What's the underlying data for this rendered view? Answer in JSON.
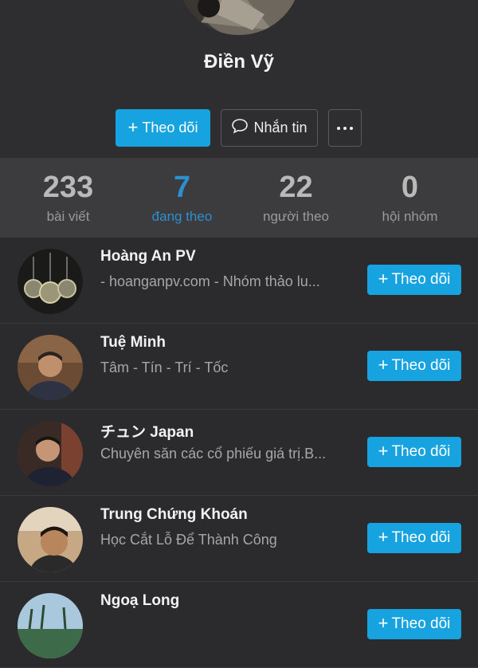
{
  "profile": {
    "name": "Điền Vỹ",
    "follow_label": "Theo dõi",
    "message_label": "Nhắn tin"
  },
  "stats": [
    {
      "value": "233",
      "label": "bài viết",
      "active": false
    },
    {
      "value": "7",
      "label": "đang theo",
      "active": true
    },
    {
      "value": "22",
      "label": "người theo",
      "active": false
    },
    {
      "value": "0",
      "label": "hội nhóm",
      "active": false
    }
  ],
  "users": [
    {
      "name": "Hoàng An PV",
      "description": "- hoanganpv.com - Nhóm thảo lu...",
      "button": "Theo dõi"
    },
    {
      "name": "Tuệ Minh",
      "description": "Tâm - Tín - Trí - Tốc",
      "button": "Theo dõi"
    },
    {
      "name": "チュン Japan",
      "description": "Chuyên săn các cổ phiếu giá trị.B...",
      "button": "Theo dõi"
    },
    {
      "name": "Trung Chứng Khoán",
      "description": "Học Cắt Lỗ Để Thành Công",
      "button": "Theo dõi"
    },
    {
      "name": "Ngoạ Long",
      "description": "",
      "button": "Theo dõi"
    }
  ],
  "colors": {
    "accent": "#17a3df",
    "active_stat": "#2b8fd0",
    "background": "#2b2b2d",
    "stats_bar": "#3c3c3e"
  },
  "icons": {
    "follow": "plus-icon",
    "message": "chat-bubble-icon",
    "more": "more-dots-icon"
  }
}
